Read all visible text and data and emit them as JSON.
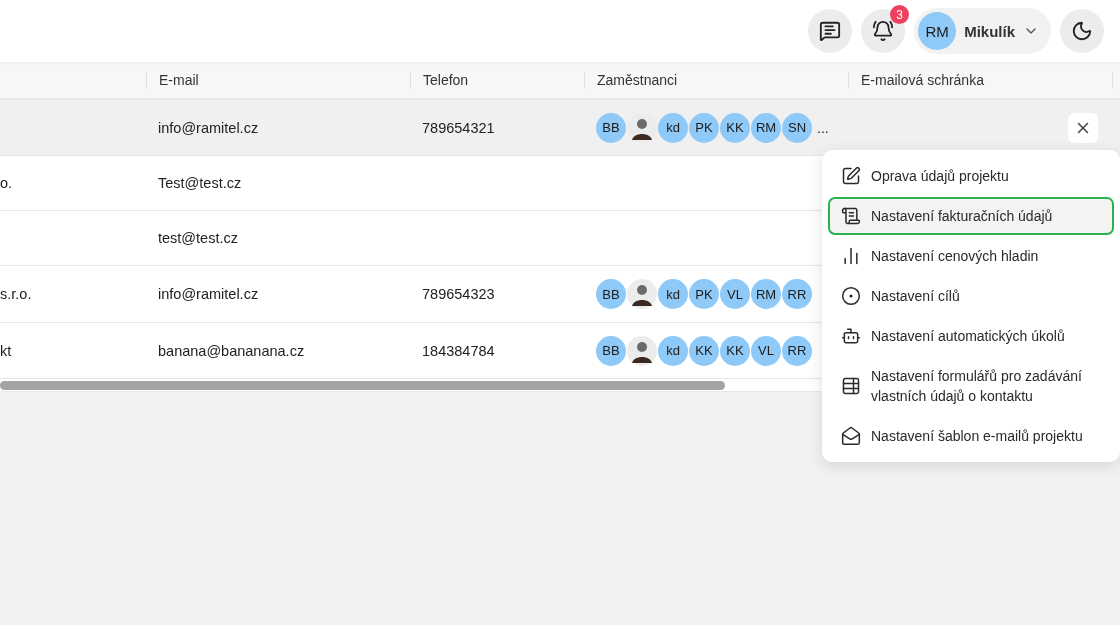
{
  "header": {
    "notifications": "3",
    "user": {
      "initials": "RM",
      "name": "Mikulík"
    }
  },
  "table": {
    "columns": [
      "E-mail",
      "Telefon",
      "Zaměstnanci",
      "E-mailová schránka"
    ],
    "rows": [
      {
        "column_1": "",
        "email": "info@ramitel.cz",
        "phone": "789654321",
        "employees": [
          {
            "kind": "initials",
            "text": "BB"
          },
          {
            "kind": "photo"
          },
          {
            "kind": "initials",
            "text": "kd"
          },
          {
            "kind": "initials",
            "text": "PK"
          },
          {
            "kind": "initials",
            "text": "KK"
          },
          {
            "kind": "initials",
            "text": "RM"
          },
          {
            "kind": "initials",
            "text": "SN"
          }
        ],
        "more": "...",
        "active": true
      },
      {
        "column_1": "o.",
        "email": "Test@test.cz",
        "phone": "",
        "employees": [],
        "active": false
      },
      {
        "column_1": "",
        "email": "test@test.cz",
        "phone": "",
        "employees": [],
        "active": false
      },
      {
        "column_1": "s.r.o.",
        "email": "info@ramitel.cz",
        "phone": "789654323",
        "employees": [
          {
            "kind": "initials",
            "text": "BB"
          },
          {
            "kind": "photo"
          },
          {
            "kind": "initials",
            "text": "kd"
          },
          {
            "kind": "initials",
            "text": "PK"
          },
          {
            "kind": "initials",
            "text": "VL"
          },
          {
            "kind": "initials",
            "text": "RM"
          },
          {
            "kind": "initials",
            "text": "RR"
          }
        ],
        "active": false
      },
      {
        "column_1": "kt",
        "email": "banana@bananana.cz",
        "phone": "184384784",
        "employees": [
          {
            "kind": "initials",
            "text": "BB"
          },
          {
            "kind": "photo"
          },
          {
            "kind": "initials",
            "text": "kd"
          },
          {
            "kind": "initials",
            "text": "KK"
          },
          {
            "kind": "initials",
            "text": "KK"
          },
          {
            "kind": "initials",
            "text": "VL"
          },
          {
            "kind": "initials",
            "text": "RR"
          }
        ],
        "active": false
      }
    ]
  },
  "menu": [
    {
      "kind": "edit",
      "label": "Oprava údajů projektu",
      "selected": false
    },
    {
      "kind": "invoice",
      "label": "Nastavení fakturačních údajů",
      "selected": true
    },
    {
      "kind": "levels",
      "label": "Nastavení cenových hladin",
      "selected": false
    },
    {
      "kind": "goals",
      "label": "Nastavení cílů",
      "selected": false
    },
    {
      "kind": "tasks",
      "label": "Nastavení automatických úkolů",
      "selected": false
    },
    {
      "kind": "forms",
      "label": "Nastavení formulářů pro zadávání vlastních údajů o kontaktu",
      "selected": false
    },
    {
      "kind": "templates",
      "label": "Nastavení šablon e-mailů projektu",
      "selected": false
    }
  ]
}
